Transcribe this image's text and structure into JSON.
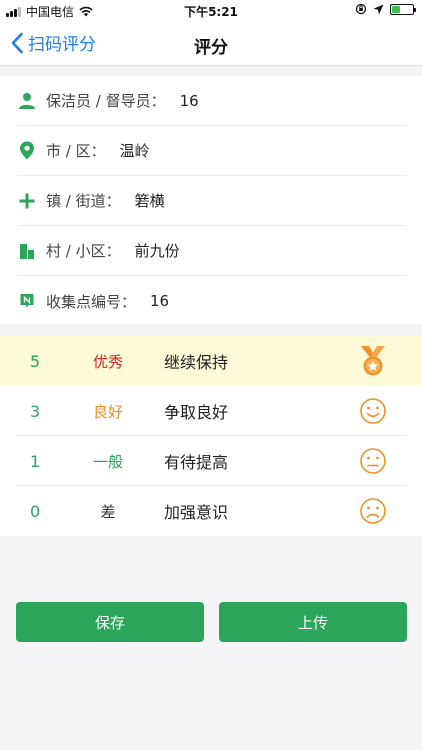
{
  "status_bar": {
    "carrier": "中国电信",
    "time": "下午5:21"
  },
  "nav": {
    "back_label": "扫码评分",
    "title": "评分"
  },
  "info": [
    {
      "icon": "person-icon",
      "label": "保洁员 / 督导员：",
      "value": "16"
    },
    {
      "icon": "location-pin-icon",
      "label": "市 / 区：",
      "value": "温岭"
    },
    {
      "icon": "plus-icon",
      "label": "镇 / 街道：",
      "value": "箬横"
    },
    {
      "icon": "building-icon",
      "label": "村 / 小区：",
      "value": "前九份"
    },
    {
      "icon": "collection-point-icon",
      "label": "收集点编号：",
      "value": "16"
    }
  ],
  "scores": [
    {
      "score": "5",
      "grade": "优秀",
      "desc": "继续保持",
      "grade_color": "#e02424",
      "icon": "medal-icon",
      "selected": true
    },
    {
      "score": "3",
      "grade": "良好",
      "desc": "争取良好",
      "grade_color": "#f0922a",
      "icon": "smile-face-icon",
      "selected": false
    },
    {
      "score": "1",
      "grade": "一般",
      "desc": "有待提高",
      "grade_color": "#2aa55a",
      "icon": "neutral-face-icon",
      "selected": false
    },
    {
      "score": "0",
      "grade": "差",
      "desc": "加强意识",
      "grade_color": "#333333",
      "icon": "sad-face-icon",
      "selected": false
    }
  ],
  "colors": {
    "accent_green": "#2aa55a",
    "link_blue": "#1f7de6",
    "icon_orange": "#f0922a",
    "selected_bg": "#fcfad7"
  },
  "buttons": {
    "save": "保存",
    "upload": "上传"
  }
}
